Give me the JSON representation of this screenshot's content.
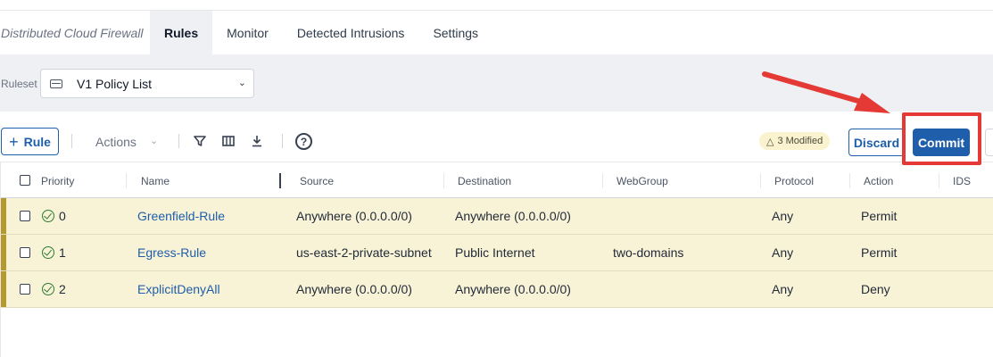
{
  "nav": {
    "brand": "Distributed Cloud Firewall",
    "tabs": [
      {
        "label": "Rules",
        "active": true
      },
      {
        "label": "Monitor",
        "active": false
      },
      {
        "label": "Detected Intrusions",
        "active": false
      },
      {
        "label": "Settings",
        "active": false
      }
    ]
  },
  "ruleset": {
    "label": "Ruleset",
    "value": "V1 Policy List"
  },
  "toolbar": {
    "add_rule_label": "Rule",
    "actions_label": "Actions",
    "modified_badge": "3 Modified",
    "discard_label": "Discard",
    "commit_label": "Commit"
  },
  "table": {
    "columns": [
      "Priority",
      "Name",
      "Source",
      "Destination",
      "WebGroup",
      "Protocol",
      "Action",
      "IDS"
    ],
    "rows": [
      {
        "priority": "0",
        "name": "Greenfield-Rule",
        "source": "Anywhere (0.0.0.0/0)",
        "destination": "Anywhere (0.0.0.0/0)",
        "webgroup": "",
        "protocol": "Any",
        "action": "Permit",
        "ids": ""
      },
      {
        "priority": "1",
        "name": "Egress-Rule",
        "source": "us-east-2-private-subnet",
        "destination": "Public Internet",
        "webgroup": "two-domains",
        "protocol": "Any",
        "action": "Permit",
        "ids": ""
      },
      {
        "priority": "2",
        "name": "ExplicitDenyAll",
        "source": "Anywhere (0.0.0.0/0)",
        "destination": "Anywhere (0.0.0.0/0)",
        "webgroup": "",
        "protocol": "Any",
        "action": "Deny",
        "ids": ""
      }
    ]
  },
  "colors": {
    "accent": "#1e5eaa",
    "modified_row": "#f8f2d6",
    "modified_stripe": "#b59a2b",
    "annotation": "#e53935"
  }
}
